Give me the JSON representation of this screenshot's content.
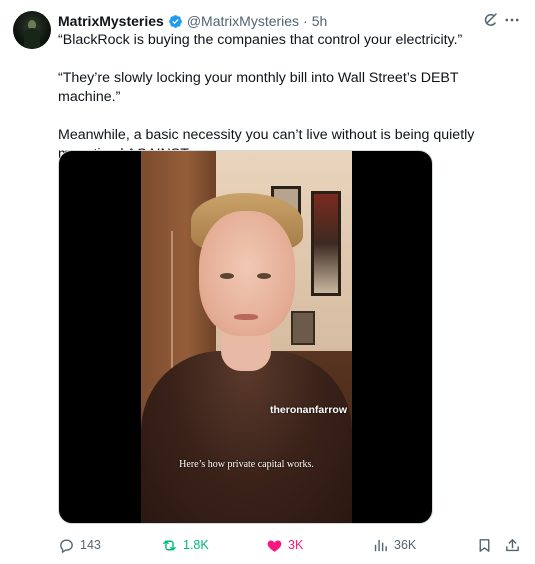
{
  "author": {
    "display_name": "MatrixMysteries",
    "handle": "@MatrixMysteries",
    "separator": "·",
    "time": "5h",
    "verified": true
  },
  "tweet_text": [
    "“BlackRock is buying the companies that control your electricity.”",
    "“They’re slowly locking your monthly bill into Wall Street’s DEBT machine.”",
    "Meanwhile, a basic necessity you can’t live without is being quietly monetized AGAINST you."
  ],
  "media": {
    "watermark": "theronanfarrow",
    "caption": "Here’s how private capital works."
  },
  "actions": {
    "replies": "143",
    "reposts": "1.8K",
    "likes": "3K",
    "views": "36K",
    "liked": true
  },
  "colors": {
    "verified_badge": "#1d9bf0",
    "repost_green": "#00ba7c",
    "like_pink": "#f91880",
    "muted_text": "#536471"
  },
  "icons": [
    "grok-icon",
    "more-icon",
    "reply-icon",
    "repost-icon",
    "heart-icon",
    "views-icon",
    "bookmark-icon",
    "share-icon"
  ]
}
